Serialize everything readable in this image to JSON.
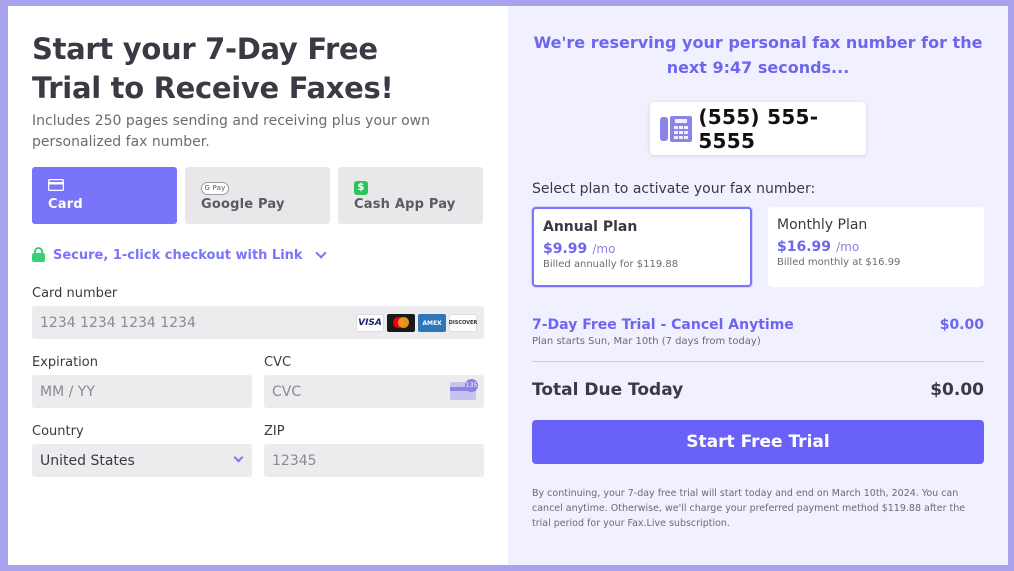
{
  "left": {
    "title": "Start your 7-Day Free Trial to Receive Faxes!",
    "subtitle": "Includes 250 pages sending and receiving plus your own personalized fax number.",
    "payment_tabs": [
      {
        "label": "Card",
        "icon": "card-icon",
        "active": true
      },
      {
        "label": "Google Pay",
        "icon": "google-pay-icon",
        "icon_text": "G Pay",
        "active": false
      },
      {
        "label": "Cash App Pay",
        "icon": "cash-app-icon",
        "icon_text": "$",
        "active": false
      }
    ],
    "link_text": "Secure, 1-click checkout with Link",
    "card_number": {
      "label": "Card number",
      "placeholder": "1234 1234 1234 1234",
      "brands": [
        "VISA",
        "Mastercard",
        "AMEX",
        "DISCOVER"
      ]
    },
    "expiration": {
      "label": "Expiration",
      "placeholder": "MM / YY"
    },
    "cvc": {
      "label": "CVC",
      "placeholder": "CVC",
      "icon_text": "135"
    },
    "country": {
      "label": "Country",
      "value": "United States"
    },
    "zip": {
      "label": "ZIP",
      "placeholder": "12345"
    }
  },
  "right": {
    "reserve_text": "We're reserving your personal fax number for the next 9:47 seconds...",
    "fax_number": "(555) 555-5555",
    "select_plan_label": "Select plan to activate your fax number:",
    "plans": [
      {
        "name": "Annual Plan",
        "price": "$9.99",
        "per": "/mo",
        "billed": "Billed annually for $119.88",
        "selected": true
      },
      {
        "name": "Monthly Plan",
        "price": "$16.99",
        "per": "/mo",
        "billed": "Billed monthly at $16.99",
        "selected": false
      }
    ],
    "trial": {
      "title": "7-Day Free Trial - Cancel Anytime",
      "subtitle": "Plan starts Sun, Mar 10th (7 days from today)",
      "price": "$0.00"
    },
    "total": {
      "label": "Total Due Today",
      "value": "$0.00"
    },
    "cta_label": "Start Free Trial",
    "legal": "By continuing, your 7-day free trial will start today and end on March 10th, 2024. You can cancel anytime. Otherwise, we'll charge your preferred payment method $119.88 after the trial period for your Fax.Live subscription."
  },
  "colors": {
    "accent": "#7a74fa",
    "cta": "#6a61fb",
    "panel": "#f0f0fe",
    "backdrop": "#a9a2ee",
    "lock": "#3ccf7a"
  }
}
